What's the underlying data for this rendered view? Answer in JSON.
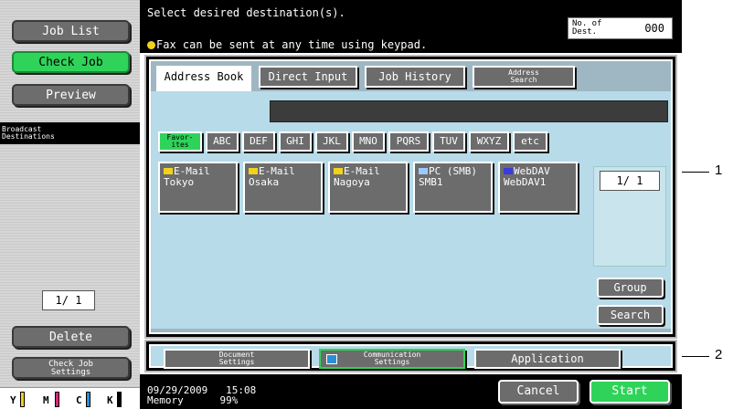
{
  "left_panel": {
    "job_list": "Job List",
    "check_job": "Check Job",
    "preview": "Preview",
    "broadcast_l1": "Broadcast",
    "broadcast_l2": "Destinations",
    "count": "1/ 1",
    "delete": "Delete",
    "check_job_settings_l1": "Check Job",
    "check_job_settings_l2": "Settings",
    "toner": [
      "Y",
      "M",
      "C",
      "K"
    ],
    "toner_colors": [
      "#f2d21d",
      "#d9247a",
      "#2a8fd6",
      "#000000"
    ]
  },
  "header": {
    "message": "Select desired destination(s).",
    "fax_note": "Fax can be sent at any time using keypad.",
    "no_of_dest_l1": "No. of",
    "no_of_dest_l2": "Dest.",
    "no_of_dest_value": "000"
  },
  "tabs": {
    "address_book": "Address Book",
    "direct_input": "Direct Input",
    "job_history": "Job History",
    "address_search_l1": "Address",
    "address_search_l2": "Search"
  },
  "index": {
    "favorites_l1": "Favor-",
    "favorites_l2": "ites",
    "keys": [
      "ABC",
      "DEF",
      "GHI",
      "JKL",
      "MNO",
      "PQRS",
      "TUV",
      "WXYZ",
      "etc"
    ]
  },
  "entries": [
    {
      "type": "E-Mail",
      "name": "Tokyo",
      "icon_color": "#f2d21d"
    },
    {
      "type": "E-Mail",
      "name": "Osaka",
      "icon_color": "#f2d21d"
    },
    {
      "type": "E-Mail",
      "name": "Nagoya",
      "icon_color": "#f2d21d"
    },
    {
      "type": "PC (SMB)",
      "name": "SMB1",
      "icon_color": "#9ec9ff"
    },
    {
      "type": "WebDAV",
      "name": "WebDAV1",
      "icon_color": "#3b3bd9"
    }
  ],
  "pager": {
    "value": "1/ 1"
  },
  "side_buttons": {
    "group": "Group",
    "search": "Search"
  },
  "bottom_tabs": {
    "document_l1": "Document",
    "document_l2": "Settings",
    "communication_l1": "Communication",
    "communication_l2": "Settings",
    "application": "Application"
  },
  "footer": {
    "date": "09/29/2009",
    "time": "15:08",
    "memory_label": "Memory",
    "memory_value": "99%",
    "cancel": "Cancel",
    "start": "Start"
  },
  "callouts": [
    "1",
    "2"
  ]
}
